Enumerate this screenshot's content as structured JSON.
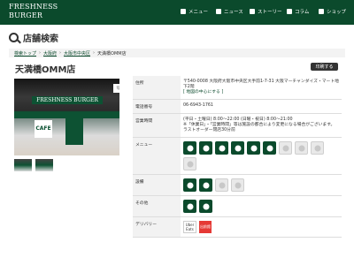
{
  "header": {
    "logo_line1": "FRESHNESS",
    "logo_line2": "BURGER",
    "nav": [
      "メニュー",
      "ニュース",
      "ストーリー",
      "コラム",
      "ショップ"
    ]
  },
  "page_title": "店舗検索",
  "breadcrumb": [
    "検索トップ",
    "大阪府",
    "大阪市中央区",
    "天満橋OMM店"
  ],
  "store_name": "天満橋OMM店",
  "print_label": "印刷する",
  "photo": {
    "sign": "FRESHNESS BURGER",
    "cafe": "CAFE",
    "badge_label": "写真"
  },
  "info": {
    "address_label": "住所",
    "address_line1": "〒540-0008 大阪府大阪市中央区大手前1-7-31 大阪マーチャンダイズ・マート地下2階",
    "address_line2": "[ 地図の中心にする ]",
    "phone_label": "電話番号",
    "phone": "06-6943-1761",
    "hours_label": "営業時間",
    "hours_line1": "(平日・土曜日) 8:00～22:00 (日曜・祝日) 8:00～21:00",
    "hours_line2": "※「休業日」・「営業時間」等は施設の都合により変更になる場合がございます。",
    "hours_line3": "ラストオーダー閉店30分前",
    "menu_label": "メニュー",
    "equipment_label": "設備",
    "other_label": "その他",
    "delivery_label": "デリバリー",
    "delivery_uber": "Uber Eats",
    "delivery_red": "出前館"
  },
  "menu_icons": [
    "burger-icon",
    "sandwich-icon",
    "soup-icon",
    "dessert-icon",
    "salad-icon",
    "drink-icon",
    "rice-icon",
    "coffee-icon",
    "glass-icon",
    "kids-icon"
  ],
  "equipment_icons": [
    "wifi-icon",
    "no-smoking-icon",
    "power-icon",
    "plug-icon"
  ],
  "other_icons": [
    "person-icon",
    "mobile-icon"
  ]
}
